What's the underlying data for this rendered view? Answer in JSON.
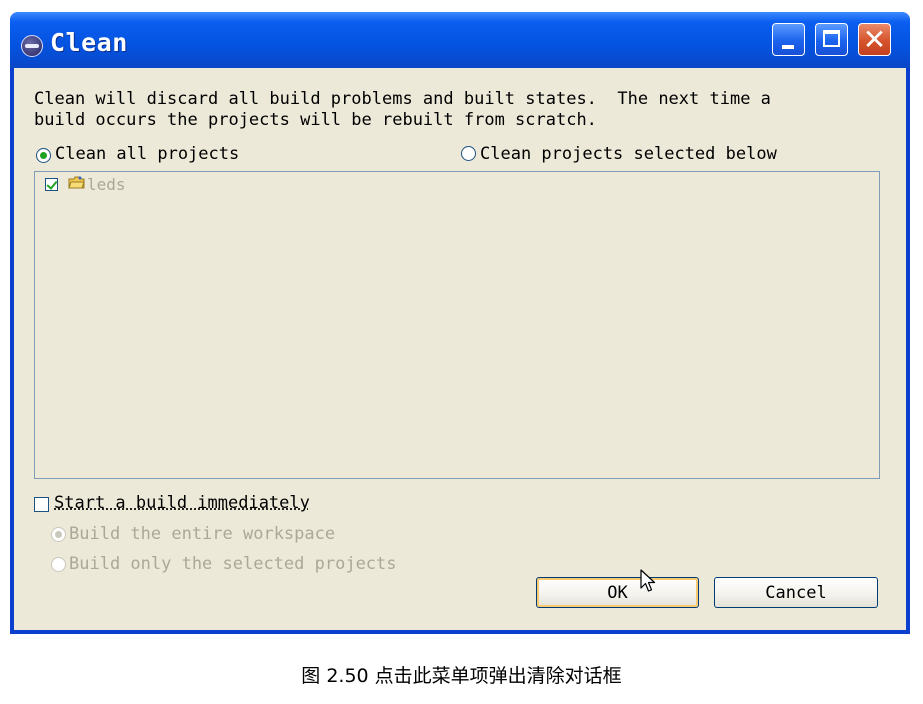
{
  "window": {
    "title": "Clean",
    "controls": {
      "minimize": "minimize",
      "maximize": "maximize",
      "close": "close"
    }
  },
  "dialog": {
    "description": "Clean will discard all build problems and built states.  The next time a\nbuild occurs the projects will be rebuilt from scratch.",
    "scope_options": [
      {
        "label": "Clean all projects",
        "selected": true
      },
      {
        "label": "Clean projects selected below",
        "selected": false
      }
    ],
    "projects": [
      {
        "name": "leds",
        "checked": true,
        "enabled": false
      }
    ],
    "start_build": {
      "label": "Start a build immediately",
      "checked": false
    },
    "build_options": [
      {
        "label": "Build the entire workspace",
        "selected": true,
        "enabled": false
      },
      {
        "label": "Build only the selected projects",
        "selected": false,
        "enabled": false
      }
    ],
    "buttons": {
      "ok": "OK",
      "cancel": "Cancel"
    }
  },
  "caption": "图 2.50 点击此菜单项弹出清除对话框",
  "icons": {
    "window_icon": "eclipse-icon",
    "project_icon": "project-folder-icon",
    "pointer": "mouse-cursor-icon"
  },
  "colors": {
    "titlebar": "#0453e0",
    "dialog_bg": "#ece9d8",
    "close_button": "#d6532c",
    "disabled_text": "#aca899"
  }
}
